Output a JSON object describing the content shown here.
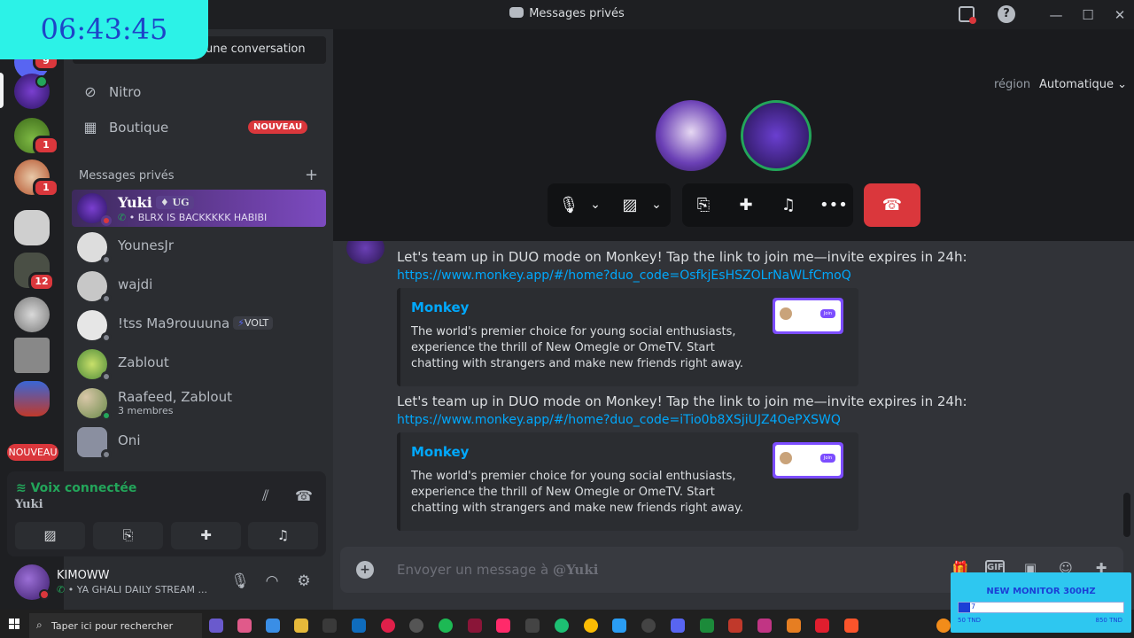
{
  "window": {
    "title": "Messages privés",
    "min": "—",
    "max": "☐",
    "close": "✕"
  },
  "clock": "06:43:45",
  "rail": {
    "badges": [
      "9",
      "1",
      "1",
      "12"
    ],
    "new_label": "NOUVEAU"
  },
  "sidebar": {
    "search_text": "une conversation",
    "nitro": "Nitro",
    "shop": "Boutique",
    "shop_badge": "NOUVEAU",
    "dm_header": "Messages privés",
    "dm_add": "+",
    "dms": [
      {
        "name": "Yuki",
        "tag": "UG",
        "sub": "BLRX IS BACKKKKK HABIBI"
      },
      {
        "name": "YounesJr"
      },
      {
        "name": "wajdi"
      },
      {
        "name": "!tss Ma9rouuuna",
        "tag": "VOLT"
      },
      {
        "name": "Zablout"
      },
      {
        "name": "Raafeed, Zablout",
        "sub": "3 membres"
      },
      {
        "name": "Oni"
      }
    ]
  },
  "voice": {
    "status": "Voix connectée",
    "channel": "Yuki"
  },
  "user": {
    "name": "KIMOWW",
    "status": "YA GHALI DAILY STREAM ..."
  },
  "call": {
    "region_label": "région",
    "region_value": "Automatique"
  },
  "messages": [
    {
      "text": "Let's team up in DUO mode on Monkey! Tap the link to join me—invite expires in 24h:",
      "link": "https://www.monkey.app/#/home?duo_code=OsfkjEsHSZOLrNaWLfCmoQ",
      "embed_title": "Monkey",
      "embed_desc": "The world's premier choice for young social enthusiasts, experience the thrill of New Omegle or OmeTV. Start chatting with strangers and make new friends right away."
    },
    {
      "text": "Let's team up in DUO mode on Monkey! Tap the link to join me—invite expires in 24h:",
      "link": "https://www.monkey.app/#/home?duo_code=iTio0b8XSjiUJZ4OePXSWQ",
      "embed_title": "Monkey",
      "embed_desc": "The world's premier choice for young social enthusiasts, experience the thrill of New Omegle or OmeTV. Start chatting with strangers and make new friends right away."
    }
  ],
  "composer": {
    "placeholder_prefix": "Envoyer un message à ",
    "recipient": "@Yuki"
  },
  "monitor": {
    "title": "NEW MONITOR 300HZ",
    "value": "7",
    "progress": 0.07,
    "left_label": "50 TND",
    "right_label": "850 TND"
  },
  "taskbar": {
    "search": "Taper ici pour rechercher"
  },
  "colors": {
    "accent": "#5865f2",
    "danger": "#da373c",
    "online": "#23a55a",
    "link": "#00a8fc"
  }
}
